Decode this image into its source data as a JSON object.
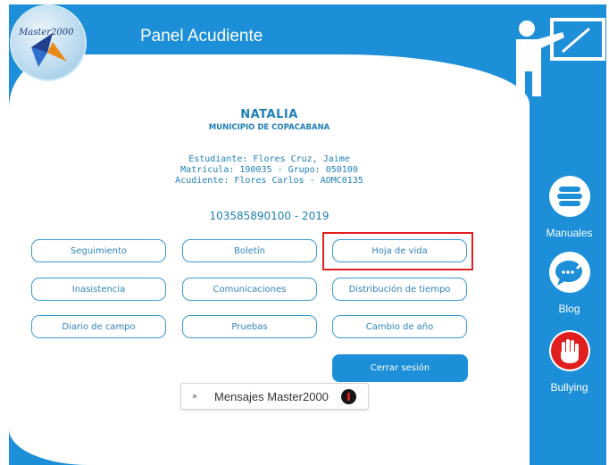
{
  "header": {
    "logo_text": "Master2000",
    "title": "Panel Acudiente"
  },
  "student": {
    "name": "NATALIA",
    "municipality": "MUNICIPIO DE COPACABANA",
    "estudiante": "Estudiante: Flores Cruz, Jaime",
    "matricula": "Matricula: 190035 - Grupo: 050100",
    "acudiente": "Acudiente: Flores Carlos - AOMC0135",
    "code_year": "103585890100 - 2019"
  },
  "buttons": {
    "seguimiento": "Seguimiento",
    "boletin": "Boletín",
    "hoja_de_vida": "Hoja de vida",
    "inasistencia": "Inasistencia",
    "comunicaciones": "Comunicaciones",
    "distribucion": "Distribución de tiempo",
    "diario": "Diario de campo",
    "pruebas": "Pruebas",
    "cambio_anio": "Cambio de año",
    "cerrar_sesion": "Cerrar sesión"
  },
  "messages": {
    "label": "Mensajes Master2000"
  },
  "sidebar": {
    "items": [
      {
        "label": "Manuales",
        "icon": "books-icon"
      },
      {
        "label": "Blog",
        "icon": "chat-bubble-icon"
      },
      {
        "label": "Bullying",
        "icon": "stop-hand-icon"
      }
    ]
  },
  "colors": {
    "brand_blue": "#1c8fd8",
    "highlight_red": "#e02020",
    "text_blue": "#1f7fb8"
  }
}
